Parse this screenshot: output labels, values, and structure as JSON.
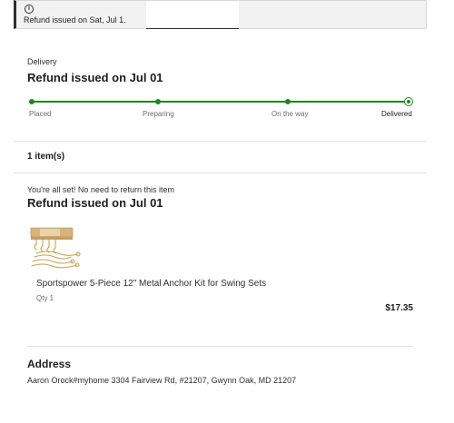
{
  "alert": {
    "icon": "info-icon",
    "text": "Refund issued on Sat, Jul 1."
  },
  "delivery": {
    "label": "Delivery",
    "title": "Refund issued on Jul 01",
    "status_color": "#1a8a1a",
    "steps": [
      {
        "label": "Placed",
        "done": true
      },
      {
        "label": "Preparing",
        "done": true
      },
      {
        "label": "On the way",
        "done": true
      },
      {
        "label": "Delivered",
        "done": true,
        "current": true
      }
    ]
  },
  "items": {
    "count_label": "1 item(s)",
    "note": "You're all set! No need to return this item",
    "refund_title": "Refund issued on Jul 01",
    "products": [
      {
        "image": "anchor-kit-image",
        "title": "Sportspower 5-Piece 12\" Metal Anchor Kit for Swing Sets",
        "qty": "Qty 1",
        "price": "$17.35"
      }
    ]
  },
  "address": {
    "title": "Address",
    "text": "Aaron Orock#myhome 3304 Fairview Rd, #21207, Gwynn Oak, MD 21207"
  }
}
